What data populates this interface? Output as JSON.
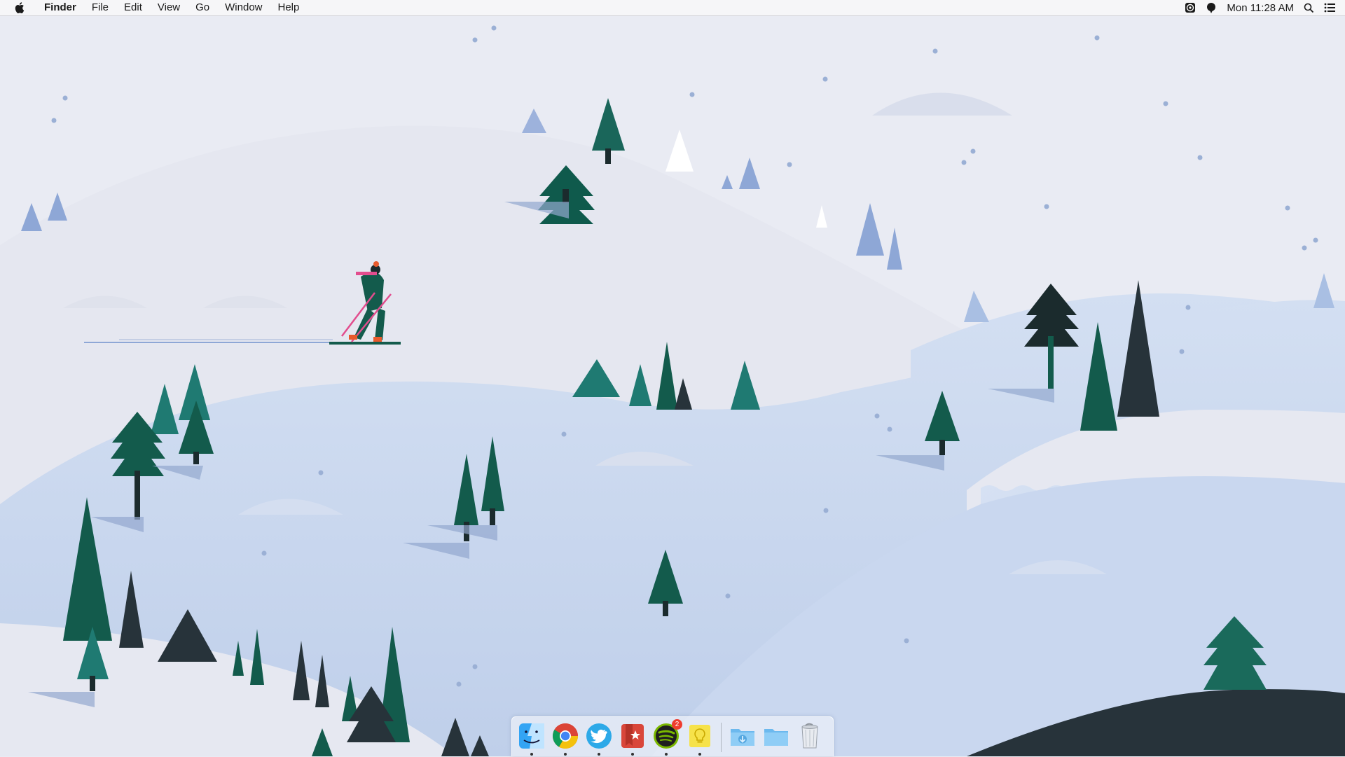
{
  "menubar": {
    "apple_icon": "apple-logo-icon",
    "app_name": "Finder",
    "menus": [
      "File",
      "Edit",
      "View",
      "Go",
      "Window",
      "Help"
    ],
    "status_icons": [
      "camera-aperture-icon",
      "notification-dot-icon"
    ],
    "clock": "Mon 11:28 AM",
    "spotlight_icon": "spotlight-search-icon",
    "notification_center_icon": "notification-center-icon"
  },
  "wallpaper": {
    "description_icon": "winter-ski-landscape-wallpaper",
    "colors": {
      "sky": "#e9ebf3",
      "snow_light": "#e4e7f1",
      "snow_blue": "#c8d6ee",
      "tree_dark": "#0f4d3c",
      "tree_teal": "#1f7a72",
      "tree_charcoal": "#27333a"
    }
  },
  "dock": {
    "apps": [
      {
        "name": "Finder",
        "icon": "finder-icon",
        "running": true
      },
      {
        "name": "Google Chrome",
        "icon": "chrome-icon",
        "running": true
      },
      {
        "name": "Twitter",
        "icon": "twitter-icon",
        "running": true
      },
      {
        "name": "Wunderlist",
        "icon": "wunderlist-icon",
        "running": true
      },
      {
        "name": "Spotify",
        "icon": "spotify-icon",
        "running": true,
        "badge": "2"
      },
      {
        "name": "Stickies",
        "icon": "lightbulb-notes-icon",
        "running": true
      }
    ],
    "stacks": [
      {
        "name": "Downloads",
        "icon": "downloads-folder-icon"
      },
      {
        "name": "Documents",
        "icon": "folder-icon"
      },
      {
        "name": "Trash",
        "icon": "trash-icon"
      }
    ]
  }
}
